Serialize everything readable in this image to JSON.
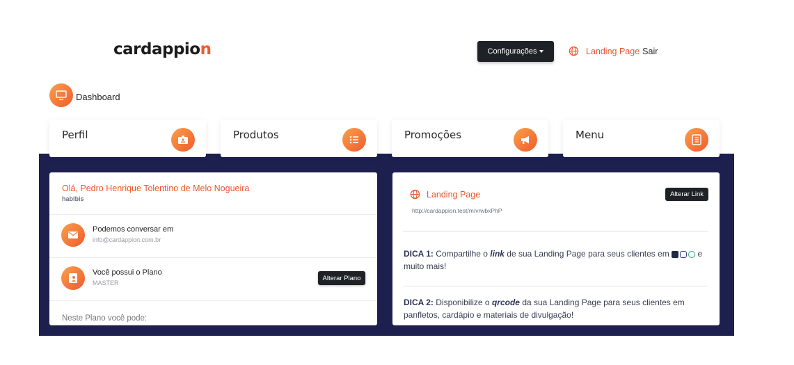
{
  "header": {
    "logo_text_main": "cardappio",
    "logo_text_accent": "n",
    "config_button": "Configurações",
    "landing_page_link": "Landing Page",
    "logout_link": "Sair"
  },
  "dashboard": {
    "title": "Dashboard"
  },
  "nav_cards": [
    {
      "label": "Perfil",
      "icon": "id-badge-icon"
    },
    {
      "label": "Produtos",
      "icon": "list-icon"
    },
    {
      "label": "Promoções",
      "icon": "megaphone-icon"
    },
    {
      "label": "Menu",
      "icon": "menu-book-icon"
    }
  ],
  "profile_panel": {
    "greeting": "Olá, Pedro Henrique Tolentino de Melo Nogueira",
    "username": "hablbis",
    "contact_title": "Podemos conversar em",
    "contact_email": "info@cardappion.com.br",
    "plan_title": "Você possui o Plano",
    "plan_name": "MASTER",
    "change_plan_button": "Alterar Plano",
    "plan_note": "Neste Plano você pode:"
  },
  "landing_panel": {
    "title": "Landing Page",
    "change_link_button": "Alterar Link",
    "url": "http://cardappion.test/m/vrwbxPhP",
    "tip1_label": "DICA 1:",
    "tip1_pre": "Compartilhe o",
    "tip1_keyword": "link",
    "tip1_post": "de sua Landing Page para seus clientes em",
    "tip1_end": "e muito mais!",
    "tip2_label": "DICA 2:",
    "tip2_pre": "Disponibilize o",
    "tip2_keyword": "qrcode",
    "tip2_post": "da sua Landing Page para seus clientes em panfletos, cardápio e materiais de divulgação!"
  },
  "colors": {
    "accent": "#f05a2d",
    "accent_light": "#f9a14b",
    "dark_band": "#1d1f4f",
    "button_dark": "#1e2227"
  }
}
